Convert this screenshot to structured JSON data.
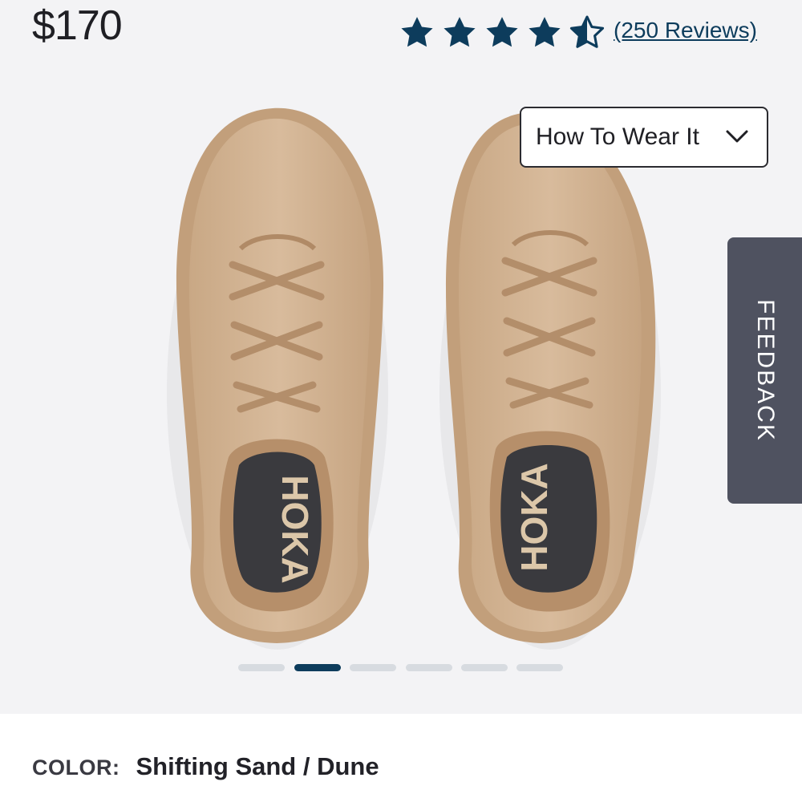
{
  "product": {
    "price": "$170",
    "rating": {
      "value": 4.5,
      "max": 5,
      "reviews_text": "(250 Reviews)"
    },
    "how_to_wear_label": "How To Wear It",
    "color_label": "COLOR:",
    "color_value": "Shifting Sand / Dune",
    "image_logo_text": "HOKA"
  },
  "feedback": {
    "label": "FEEDBACK"
  },
  "carousel": {
    "count": 6,
    "active_index": 1
  },
  "colors": {
    "accent": "#0d3c5c",
    "shoe": "#d4b595",
    "feedback_bg": "#4f5260",
    "dot_inactive": "#d7dbe0"
  },
  "icons": {
    "star": "star-icon",
    "half_star": "half-star-icon",
    "chevron": "chevron-down-icon"
  }
}
